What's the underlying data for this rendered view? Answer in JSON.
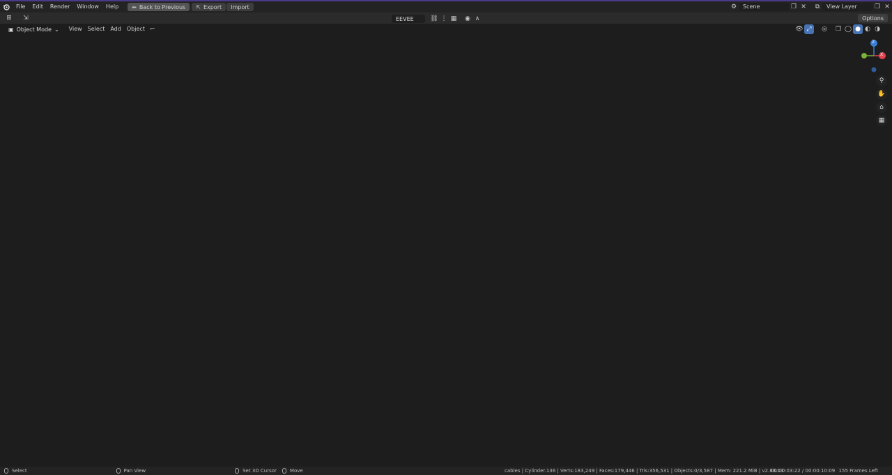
{
  "menubar": {
    "items": [
      "File",
      "Edit",
      "Render",
      "Window",
      "Help"
    ],
    "back_to_previous": "Back to Previous",
    "export": "Export",
    "import": "Import",
    "scene": "Scene",
    "view_layer": "View Layer"
  },
  "toolrow": {
    "render_engine": "EEVEE",
    "options": "Options"
  },
  "viewport_header": {
    "mode": "Object Mode",
    "menus": [
      "View",
      "Select",
      "Add",
      "Object"
    ]
  },
  "statusbar": {
    "select": "Select",
    "pan_view": "Pan View",
    "set_cursor": "Set 3D Cursor",
    "move": "Move",
    "stats": "cables | Cylinder.136 | Verts:183,249 | Faces:179,446 | Tris:356,531 | Objects:0/3,587 | Mem: 221.2 MiB | v2.83.13",
    "time": "00:00:03:22 / 00:00:10:09",
    "frames_left": "155 Frames Left"
  },
  "gizmo": {
    "z": "Z",
    "x": "X",
    "y": "Y"
  },
  "colors": {
    "accent_blue": "#4772b3",
    "axis_x": "#e0434f",
    "axis_y": "#7ab33a",
    "axis_z": "#3b7fd6",
    "sky": "#3b3b3b",
    "floor": "#767676"
  },
  "icons": [
    "blender-logo-icon",
    "editor-type-icon",
    "select-tool-icon",
    "scene-icon",
    "view-layer-icon",
    "zoom-icon",
    "pan-hand-icon",
    "camera-icon",
    "grid-icon"
  ]
}
